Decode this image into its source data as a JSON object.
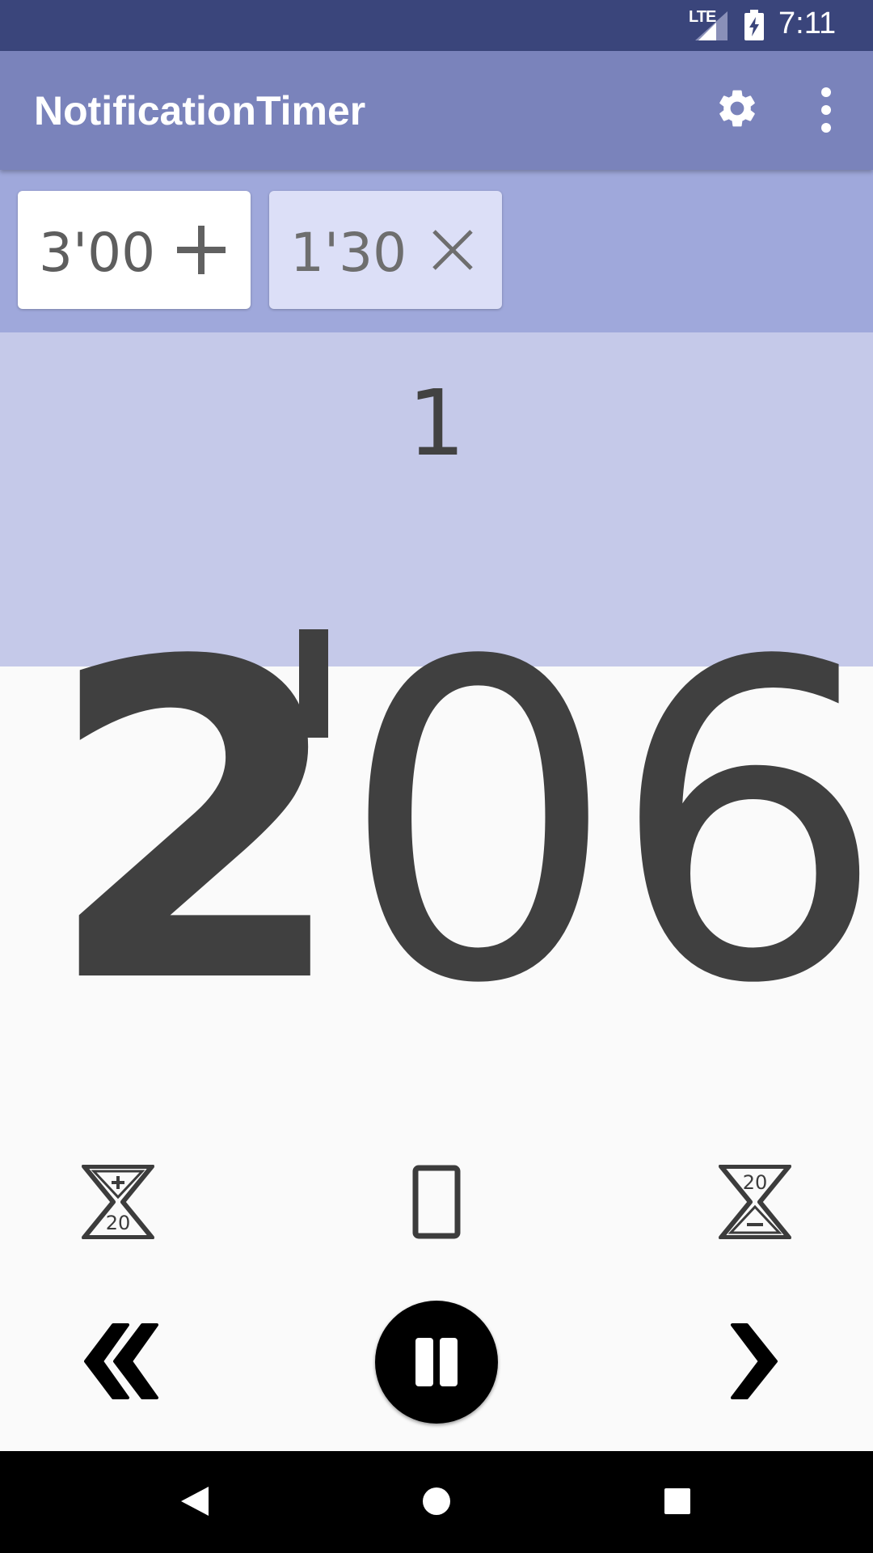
{
  "status_bar": {
    "network": "LTE",
    "time": "7:11",
    "icons": [
      "signal-icon",
      "battery-charging-icon"
    ]
  },
  "app_bar": {
    "title": "NotificationTimer",
    "icons": [
      "settings-icon",
      "more-vert-icon"
    ]
  },
  "chips": [
    {
      "label": "3'00",
      "icon": "plus-icon"
    },
    {
      "label": "1'30",
      "icon": "close-icon"
    }
  ],
  "timer": {
    "count": "1",
    "minutes": "2",
    "seconds": "06"
  },
  "controls": {
    "add_time_label": "20",
    "subtract_time_label": "20",
    "icons": [
      "hourglass-add-icon",
      "phone-screen-icon",
      "hourglass-subtract-icon",
      "rewind-icon",
      "pause-icon",
      "next-icon"
    ]
  },
  "nav_bar": {
    "icons": [
      "back-icon",
      "home-icon",
      "recents-icon"
    ]
  },
  "colors": {
    "status_bar": "#3a457b",
    "app_bar": "#7a83bb",
    "chip_strip": "#9fa8db",
    "count_area": "#c5c9e9",
    "text_dark": "#404040"
  }
}
